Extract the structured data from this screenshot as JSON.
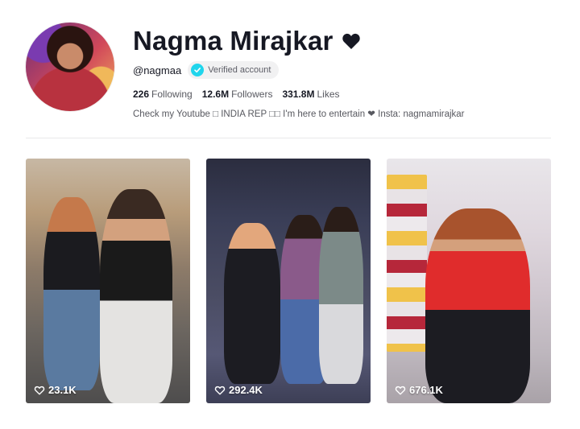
{
  "profile": {
    "name": "Nagma Mirajkar",
    "handle": "@nagmaa",
    "verified_label": "Verified account",
    "stats": {
      "following_count": "226",
      "following_label": "Following",
      "followers_count": "12.6M",
      "followers_label": "Followers",
      "likes_count": "331.8M",
      "likes_label": "Likes"
    },
    "bio": "Check my Youtube □ INDIA REP □□ I'm here to entertain ❤ Insta: nagmamirajkar"
  },
  "videos": [
    {
      "likes": "23.1K"
    },
    {
      "likes": "292.4K"
    },
    {
      "likes": "676.1K"
    }
  ],
  "colors": {
    "text_primary": "#161823",
    "text_secondary": "#57585f",
    "verified": "#20d5ec",
    "pill_bg": "#f1f1f2"
  },
  "icons": [
    "heart-icon",
    "verified-check-icon",
    "heart-outline-icon"
  ]
}
